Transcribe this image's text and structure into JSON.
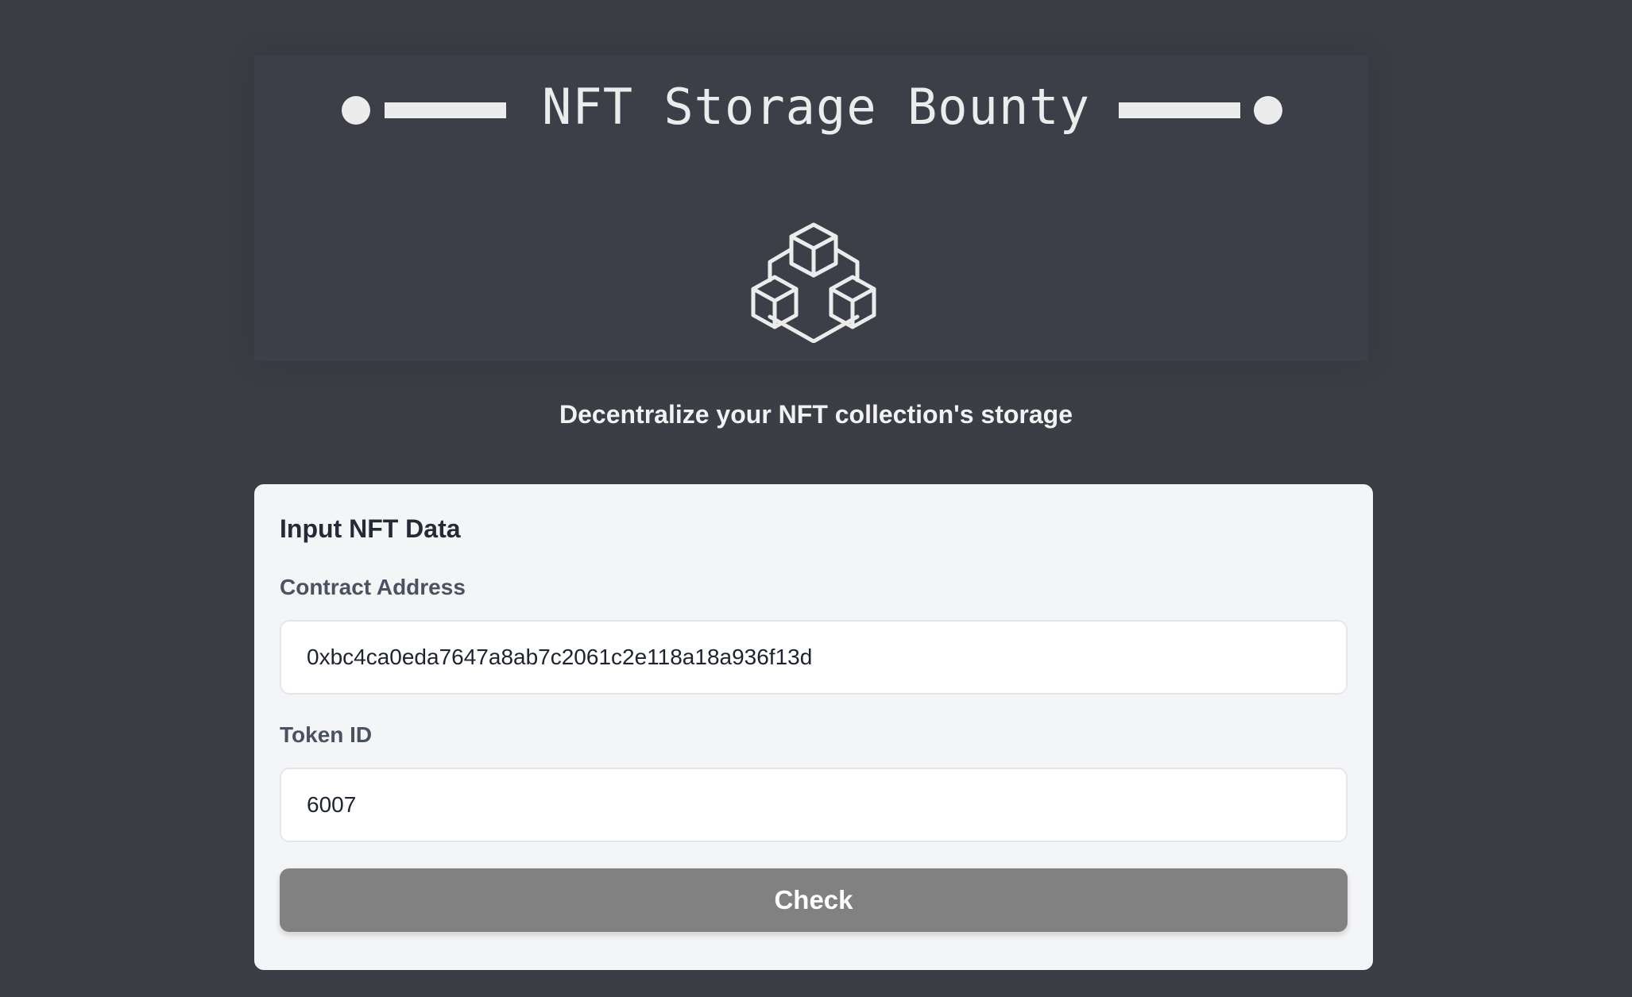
{
  "header": {
    "title": "NFT Storage Bounty",
    "tagline": "Decentralize your NFT collection's storage",
    "logo_icon": "cubes-network-icon"
  },
  "form": {
    "title": "Input NFT Data",
    "contract_address": {
      "label": "Contract Address",
      "value": "0xbc4ca0eda7647a8ab7c2061c2e118a18a936f13d"
    },
    "token_id": {
      "label": "Token ID",
      "value": "6007"
    },
    "submit_label": "Check"
  },
  "colors": {
    "background": "#3b3e45",
    "card": "#f4f5f7",
    "button": "#818181",
    "text_light": "#ececec"
  }
}
